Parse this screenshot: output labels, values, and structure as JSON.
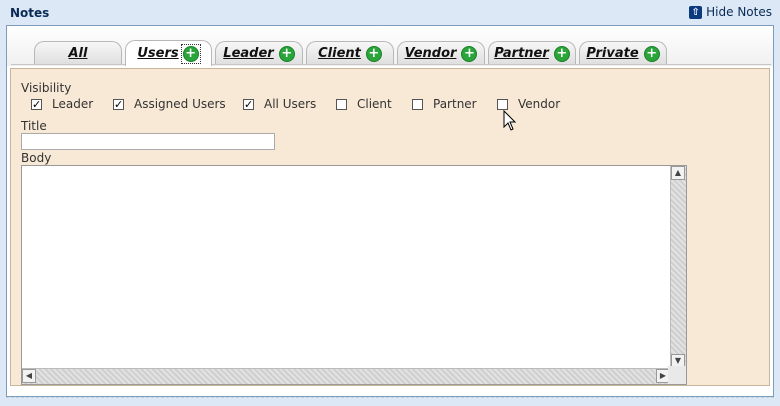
{
  "header": {
    "title": "Notes",
    "hide_label": "Hide Notes"
  },
  "tabs": [
    {
      "label": "All",
      "has_add": false
    },
    {
      "label": "Users",
      "has_add": true,
      "active": true
    },
    {
      "label": "Leader",
      "has_add": true
    },
    {
      "label": "Client",
      "has_add": true
    },
    {
      "label": "Vendor",
      "has_add": true
    },
    {
      "label": "Partner",
      "has_add": true
    },
    {
      "label": "Private",
      "has_add": true
    }
  ],
  "form": {
    "visibility_label": "Visibility",
    "checkboxes": [
      {
        "label": "Leader",
        "checked": true
      },
      {
        "label": "Assigned Users",
        "checked": true
      },
      {
        "label": "All Users",
        "checked": true
      },
      {
        "label": "Client",
        "checked": false
      },
      {
        "label": "Partner",
        "checked": false
      },
      {
        "label": "Vendor",
        "checked": false
      }
    ],
    "title_label": "Title",
    "title_value": "",
    "body_label": "Body",
    "body_value": ""
  },
  "colors": {
    "panel_bg": "#f8e8d6",
    "add_green": "#29a53a",
    "page_bg": "#dce8f5"
  }
}
